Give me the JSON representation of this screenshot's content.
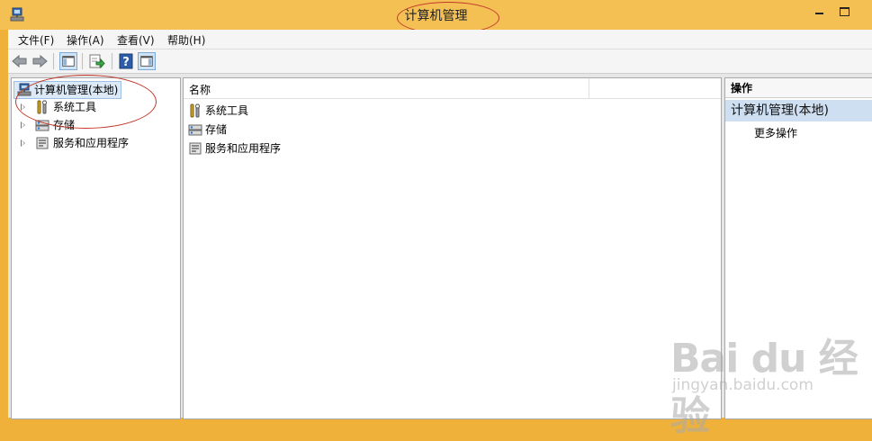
{
  "window": {
    "title": "计算机管理"
  },
  "menu": {
    "items": [
      "文件(F)",
      "操作(A)",
      "查看(V)",
      "帮助(H)"
    ]
  },
  "toolbar": {
    "buttons": [
      "back-arrow-icon",
      "forward-arrow-icon",
      "show-hide-tree-icon",
      "export-list-icon",
      "help-icon",
      "show-hide-action-pane-icon"
    ]
  },
  "tree": {
    "root": "计算机管理(本地)",
    "items": [
      "系统工具",
      "存储",
      "服务和应用程序"
    ]
  },
  "list": {
    "column_name": "名称",
    "rows": [
      "系统工具",
      "存储",
      "服务和应用程序"
    ]
  },
  "actions": {
    "header": "操作",
    "section": "计算机管理(本地)",
    "items": [
      "更多操作"
    ]
  },
  "watermark": {
    "logo": "Bai du 经验",
    "url": "jingyan.baidu.com"
  },
  "colors": {
    "titlebar": "#f4c054",
    "frame": "#f0b13b",
    "selection": "#dce9f7",
    "action_section": "#cfdff2",
    "annotation_oval": "#c0392b"
  }
}
